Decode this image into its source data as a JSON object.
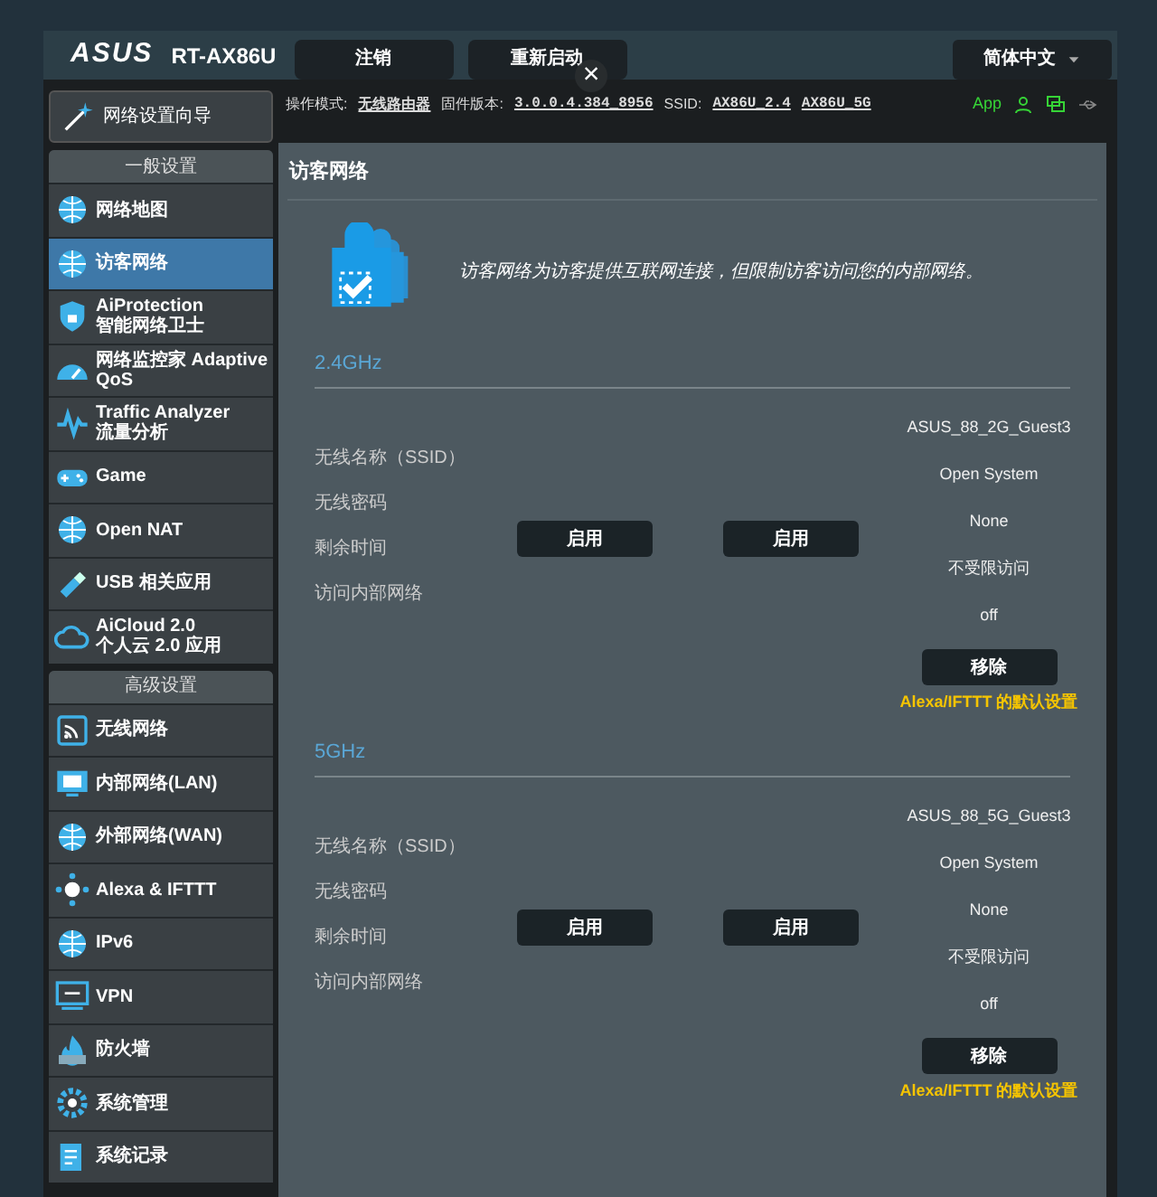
{
  "header": {
    "logo": "ASUS",
    "model": "RT-AX86U",
    "buttons": [
      "注销",
      "重新启动"
    ],
    "language": "简体中文"
  },
  "status_bar": {
    "op_mode_label": "操作模式:",
    "op_mode": "无线路由器",
    "firmware_label": "固件版本:",
    "firmware": "3.0.0.4.384_8956",
    "ssid_label": "SSID:",
    "ssids": [
      "AX86U_2.4",
      "AX86U_5G"
    ],
    "app": "App"
  },
  "sidebar": {
    "wizard": "网络设置向导",
    "sections": [
      {
        "title": "一般设置",
        "items": [
          {
            "label": "网络地图",
            "selected": false
          },
          {
            "label": "访客网络",
            "selected": true
          },
          {
            "label": "AiProtection\n智能网络卫士",
            "selected": false
          },
          {
            "label": "网络监控家 Adaptive\nQoS",
            "selected": false
          },
          {
            "label": "Traffic Analyzer\n流量分析",
            "selected": false
          },
          {
            "label": "Game",
            "selected": false
          },
          {
            "label": "Open NAT",
            "selected": false
          },
          {
            "label": "USB 相关应用",
            "selected": false
          },
          {
            "label": "AiCloud 2.0\n个人云 2.0 应用",
            "selected": false
          }
        ]
      },
      {
        "title": "高级设置",
        "items": [
          {
            "label": "无线网络",
            "selected": false
          },
          {
            "label": "内部网络(LAN)",
            "selected": false
          },
          {
            "label": "外部网络(WAN)",
            "selected": false
          },
          {
            "label": "Alexa & IFTTT",
            "selected": false
          },
          {
            "label": "IPv6",
            "selected": false
          },
          {
            "label": "VPN",
            "selected": false
          },
          {
            "label": "防火墙",
            "selected": false
          },
          {
            "label": "系统管理",
            "selected": false
          },
          {
            "label": "系统记录",
            "selected": false
          }
        ]
      }
    ]
  },
  "page": {
    "title": "访客网络",
    "description": "访客网络为访客提供互联网连接，但限制访客访问您的内部网络。",
    "bands": [
      {
        "name": "2.4GHz",
        "labels": [
          "无线名称（SSID）",
          "无线密码",
          "剩余时间",
          "访问内部网络"
        ],
        "enable_buttons": [
          "启用",
          "启用"
        ],
        "guest": {
          "values": [
            "ASUS_88_2G_Guest3",
            "Open System",
            "None",
            "不受限访问",
            "off"
          ],
          "remove": "移除",
          "link": "Alexa/IFTTT 的默认设置"
        }
      },
      {
        "name": "5GHz",
        "labels": [
          "无线名称（SSID）",
          "无线密码",
          "剩余时间",
          "访问内部网络"
        ],
        "enable_buttons": [
          "启用",
          "启用"
        ],
        "guest": {
          "values": [
            "ASUS_88_5G_Guest3",
            "Open System",
            "None",
            "不受限访问",
            "off"
          ],
          "remove": "移除",
          "link": "Alexa/IFTTT 的默认设置"
        }
      }
    ]
  },
  "overlay": {
    "close": "×"
  }
}
